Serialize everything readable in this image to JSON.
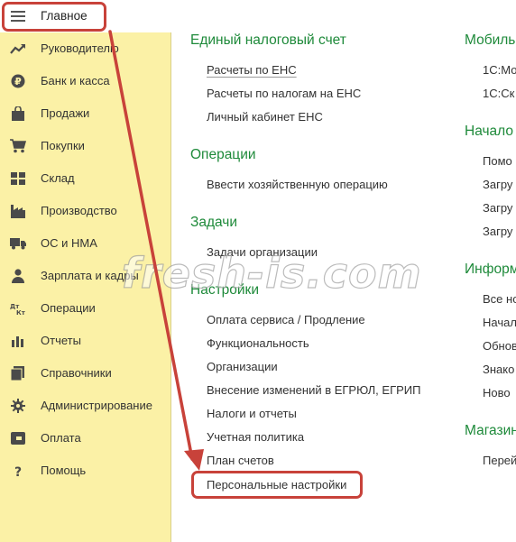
{
  "sidebar": {
    "items": [
      {
        "label": "Главное",
        "icon": "menu-lines-icon"
      },
      {
        "label": "Руководителю",
        "icon": "trend-icon"
      },
      {
        "label": "Банк и касса",
        "icon": "ruble-coin-icon"
      },
      {
        "label": "Продажи",
        "icon": "shopping-bag-icon"
      },
      {
        "label": "Покупки",
        "icon": "shopping-cart-icon"
      },
      {
        "label": "Склад",
        "icon": "warehouse-boxes-icon"
      },
      {
        "label": "Производство",
        "icon": "factory-icon"
      },
      {
        "label": "ОС и НМА",
        "icon": "truck-icon"
      },
      {
        "label": "Зарплата и кадры",
        "icon": "person-icon"
      },
      {
        "label": "Операции",
        "icon": "dt-kt-icon"
      },
      {
        "label": "Отчеты",
        "icon": "bar-chart-icon"
      },
      {
        "label": "Справочники",
        "icon": "books-icon"
      },
      {
        "label": "Администрирование",
        "icon": "gear-icon"
      },
      {
        "label": "Оплата",
        "icon": "payment-icon"
      },
      {
        "label": "Помощь",
        "icon": "question-icon"
      }
    ]
  },
  "col1": {
    "groups": [
      {
        "title": "Единый налоговый счет",
        "links": [
          "Расчеты по ЕНС",
          "Расчеты по налогам на ЕНС",
          "Личный кабинет ЕНС"
        ]
      },
      {
        "title": "Операции",
        "links": [
          "Ввести хозяйственную операцию"
        ]
      },
      {
        "title": "Задачи",
        "links": [
          "Задачи организации"
        ]
      },
      {
        "title": "Настройки",
        "links": [
          "Оплата сервиса / Продление",
          "Функциональность",
          "Организации",
          "Внесение изменений в ЕГРЮЛ, ЕГРИП",
          "Налоги и отчеты",
          "Учетная политика",
          "План счетов",
          "Персональные настройки"
        ]
      }
    ]
  },
  "col2": {
    "groups": [
      {
        "title": "Мобиль",
        "links": [
          "1С:Мо",
          "1С:Ск"
        ]
      },
      {
        "title": "Начало",
        "links": [
          "Помо",
          "Загру",
          "Загру",
          "Загру"
        ]
      },
      {
        "title": "Информ",
        "links": [
          "Все но",
          "Начал",
          "Обнов",
          "Знако",
          "Ново"
        ]
      },
      {
        "title": "Магазин",
        "links": [
          "Перей"
        ]
      }
    ]
  },
  "watermark": "fresh-is.com",
  "colors": {
    "sidebar_bg": "#fbf1a6",
    "group_title": "#1e8a3a",
    "highlight": "#c8423a"
  }
}
